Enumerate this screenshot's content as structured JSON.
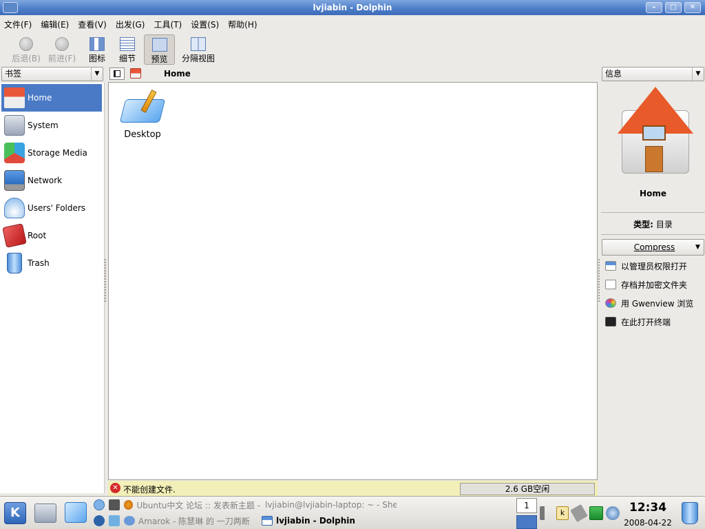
{
  "window": {
    "title": "lvjiabin - Dolphin"
  },
  "menu": [
    "文件(F)",
    "编辑(E)",
    "查看(V)",
    "出发(G)",
    "工具(T)",
    "设置(S)",
    "帮助(H)"
  ],
  "toolbar": {
    "back": "后退(B)",
    "forward": "前进(F)",
    "icons": "图标",
    "details": "细节",
    "preview": "预览",
    "split": "分隔视图"
  },
  "places": {
    "combo": "书签",
    "items": [
      {
        "label": "Home",
        "icon": "home-icon",
        "selected": true
      },
      {
        "label": "System",
        "icon": "system-icon"
      },
      {
        "label": "Storage Media",
        "icon": "storage-icon"
      },
      {
        "label": "Network",
        "icon": "network-icon"
      },
      {
        "label": "Users' Folders",
        "icon": "users-folders-icon"
      },
      {
        "label": "Root",
        "icon": "root-icon"
      },
      {
        "label": "Trash",
        "icon": "trash-icon"
      }
    ]
  },
  "breadcrumb": {
    "current": "Home"
  },
  "files": [
    {
      "name": "Desktop",
      "icon": "desktop-folder-icon"
    }
  ],
  "status": {
    "message": "不能创建文件.",
    "free_space": "2.6 GB空闲"
  },
  "info": {
    "combo": "信息",
    "name": "Home",
    "type_label": "类型:",
    "type_value": "目录",
    "compress": "Compress",
    "actions": [
      "以管理员权限打开",
      "存档并加密文件夹",
      "用 Gwenview 浏览",
      "在此打开终端"
    ]
  },
  "taskbar": {
    "tasks": [
      "Ubuntu中文 论坛 :: 发表新主题 -",
      "lvjiabin@lvjiabin-laptop: ~ - She",
      "Amarok - 陈慧琳 的 一刀两断",
      "lvjiabin - Dolphin"
    ],
    "desktop_number": "1",
    "time": "12:34",
    "date": "2008-04-22"
  },
  "colors": {
    "selection": "#4a7ac5",
    "titlebar": "#4f7fcb",
    "status_bg": "#f2efb8"
  }
}
